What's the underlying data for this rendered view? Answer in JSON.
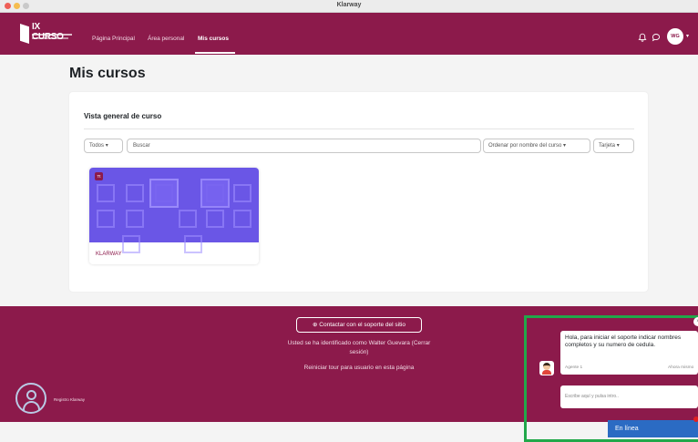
{
  "window": {
    "title": "Klarway"
  },
  "navbar": {
    "logo_text": "IX CURSO",
    "items": [
      {
        "label": "Página Principal",
        "active": false
      },
      {
        "label": "Área personal",
        "active": false
      },
      {
        "label": "Mis cursos",
        "active": true
      }
    ],
    "bell_icon": "bell-icon",
    "chat_icon": "chat-icon",
    "user_initials": "WG"
  },
  "page": {
    "title": "Mis cursos"
  },
  "course_overview": {
    "title": "Vista general de curso",
    "filter_label": "Todos",
    "search_placeholder": "Buscar",
    "sort_label": "Ordenar por nombre del curso",
    "view_label": "Tarjeta",
    "courses": [
      {
        "badge": "Tt",
        "name": "KLARWAY"
      }
    ]
  },
  "footer": {
    "support_button": "Contactar con el soporte del sitio",
    "logged_in_line1": "Usted se ha identificado como Walter Guevara (Cerrar",
    "logged_in_line2": "sesión)",
    "reset_tour": "Reiniciar tour para usuario en esta página",
    "brand": "Registro Klarway"
  },
  "chat": {
    "close_symbol": "×",
    "message": "Hola, para iniciar el soporte indicar nombres completos y su numero de cedula.",
    "agent": "Agente 1",
    "time": "Ahora mismo",
    "input_placeholder": "Escribe aquí y pulsa intro..",
    "status": "En línea",
    "colors": {
      "frame": "#21a84a",
      "status_bar": "#2b6bc3"
    }
  },
  "colors": {
    "brand": "#8c1a4b",
    "course_image": "#6a56e6"
  }
}
